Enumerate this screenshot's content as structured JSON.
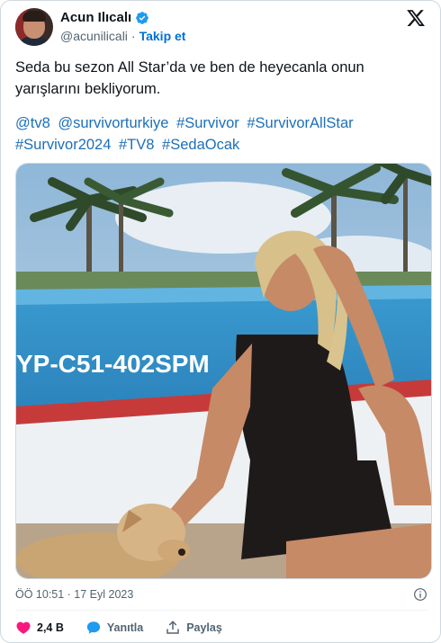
{
  "author": {
    "name": "Acun Ilıcalı",
    "handle": "@acunilicali",
    "separator": "·",
    "follow_label": "Takip et"
  },
  "tweet": {
    "text_line1": "Seda bu sezon All Star’da ve ben de heyecanla onun",
    "text_line2": "yarışlarını bekliyorum.",
    "hashtags": [
      "@tv8",
      "@survivorturkiye",
      "#Survivor",
      "#SurvivorAllStar",
      "#Survivor2024",
      "#TV8",
      "#SedaOcak"
    ]
  },
  "media": {
    "boat_text": "YP-C51-402SPM"
  },
  "meta": {
    "timestamp": "ÖÖ 10:51 · 17 Eyl 2023"
  },
  "actions": {
    "likes": "2,4 B",
    "reply_label": "Yanıtla",
    "share_label": "Paylaş"
  },
  "colors": {
    "link": "#1d6fb8",
    "follow": "#006fd6",
    "like": "#f91880",
    "reply": "#1d9bf0",
    "verified": "#1d9bf0"
  },
  "icons": [
    "verified-badge-icon",
    "x-logo-icon",
    "info-icon",
    "heart-icon",
    "reply-bubble-icon",
    "share-icon"
  ]
}
